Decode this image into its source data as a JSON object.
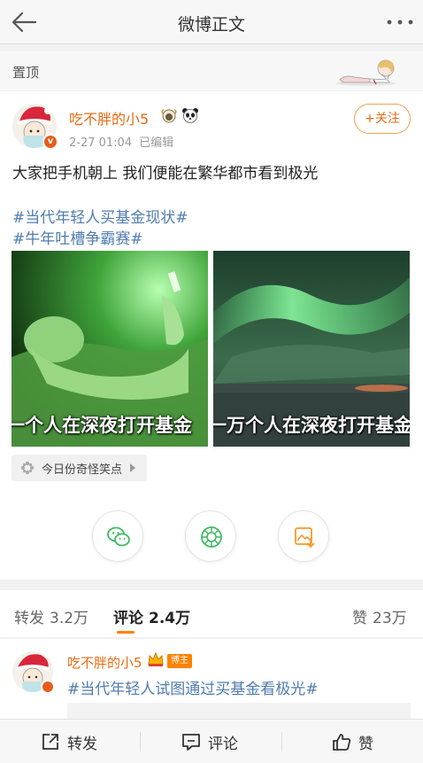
{
  "navbar": {
    "title": "微博正文"
  },
  "pin": {
    "label": "置顶"
  },
  "post": {
    "username": "吃不胖的小5",
    "time": "2-27 01:04",
    "edited": "已编辑",
    "follow_label": "+关注",
    "text": "大家把手机朝上 我们便能在繁华都市看到极光",
    "topics": [
      "#当代年轻人买基金现状#",
      "#牛年吐槽争霸赛#"
    ],
    "images": [
      {
        "caption": "一个人在深夜打开基金"
      },
      {
        "caption": "一万个人在深夜打开基金"
      }
    ],
    "tag_label": "今日份奇怪笑点"
  },
  "share": {
    "icons": [
      "wechat-icon",
      "moments-icon",
      "save-image-icon"
    ]
  },
  "tabs": {
    "repost_label": "转发",
    "repost_count": "3.2万",
    "comment_label": "评论",
    "comment_count": "2.4万",
    "like_label": "赞",
    "like_count": "23万"
  },
  "comment": {
    "username": "吃不胖的小5",
    "badge": "博主",
    "text": "#当代年轻人试图通过买基金看极光#"
  },
  "bottom_bar": {
    "repost": "转发",
    "comment": "评论",
    "like": "赞"
  },
  "colors": {
    "accent": "#ff8200",
    "username": "#e86b12",
    "link": "#507daf"
  }
}
